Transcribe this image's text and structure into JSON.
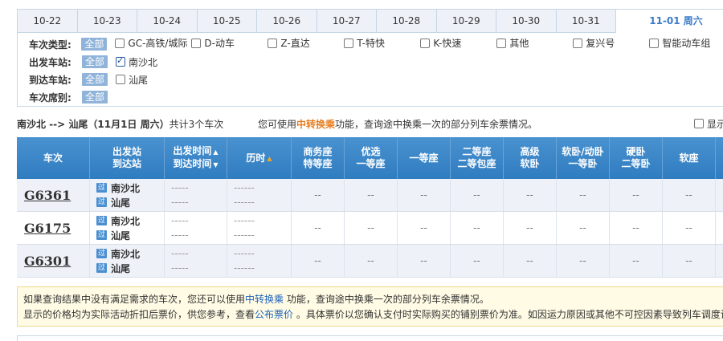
{
  "dates": [
    "10-22",
    "10-23",
    "10-24",
    "10-25",
    "10-26",
    "10-27",
    "10-28",
    "10-29",
    "10-30",
    "10-31",
    "11-01 周六"
  ],
  "filters": {
    "type_label": "车次类型:",
    "from_label": "出发车站:",
    "to_label": "到达车站:",
    "seat_label": "车次席别:",
    "all_label": "全部",
    "types": [
      "GC-高铁/城际",
      "D-动车",
      "Z-直达",
      "T-特快",
      "K-快速",
      "其他",
      "复兴号",
      "智能动车组"
    ],
    "from_station": "南沙北",
    "to_station": "汕尾"
  },
  "summary": {
    "route": "南沙北 --> 汕尾（11月1日  周六）",
    "count": "共计3个车次",
    "hint_prefix": "您可使用",
    "hint_link": "中转换乘",
    "hint_suffix": "功能，查询途中换乘一次的部分列车余票情况。",
    "show_label": "显示"
  },
  "headers": {
    "train": "车次",
    "station_1": "出发站",
    "station_2": "到达站",
    "time_1": "出发时间",
    "time_2": "到达时间",
    "duration": "历时",
    "sort_up": "▲",
    "sort_down": "▼",
    "seats": [
      [
        "商务座",
        "特等座"
      ],
      [
        "优选",
        "一等座"
      ],
      [
        "一等座",
        ""
      ],
      [
        "二等座",
        "二等包座"
      ],
      [
        "高级",
        "软卧"
      ],
      [
        "软卧/动卧",
        "一等卧"
      ],
      [
        "硬卧",
        "二等卧"
      ],
      [
        "软座",
        ""
      ]
    ]
  },
  "rows": [
    {
      "train": "G6361",
      "from": "南沙北",
      "to": "汕尾",
      "badge": "过",
      "time_placeholder": "-----",
      "dur_placeholder": "------",
      "seat_value": "--"
    },
    {
      "train": "G6175",
      "from": "南沙北",
      "to": "汕尾",
      "badge": "过",
      "time_placeholder": "-----",
      "dur_placeholder": "------",
      "seat_value": "--"
    },
    {
      "train": "G6301",
      "from": "南沙北",
      "to": "汕尾",
      "badge": "过",
      "time_placeholder": "-----",
      "dur_placeholder": "------",
      "seat_value": "--"
    }
  ],
  "notice": {
    "line1_prefix": "如果查询结果中没有满足需求的车次，您还可以使用",
    "line1_link": "中转换乘",
    "line1_suffix": " 功能，查询途中换乘一次的部分列车余票情况。",
    "line2_prefix": "显示的价格均为实际活动折扣后票价，供您参考，查看",
    "line2_link": "公布票价",
    "line2_suffix": " 。具体票价以您确认支付时实际购买的铺别票价为准。如因运力原因或其他不可控因素导致列车调度调"
  },
  "colors": {
    "header_bg": "#3a86c8",
    "accent": "#3a7bc8",
    "highlight": "#e67e22",
    "link": "#1e63b8"
  }
}
